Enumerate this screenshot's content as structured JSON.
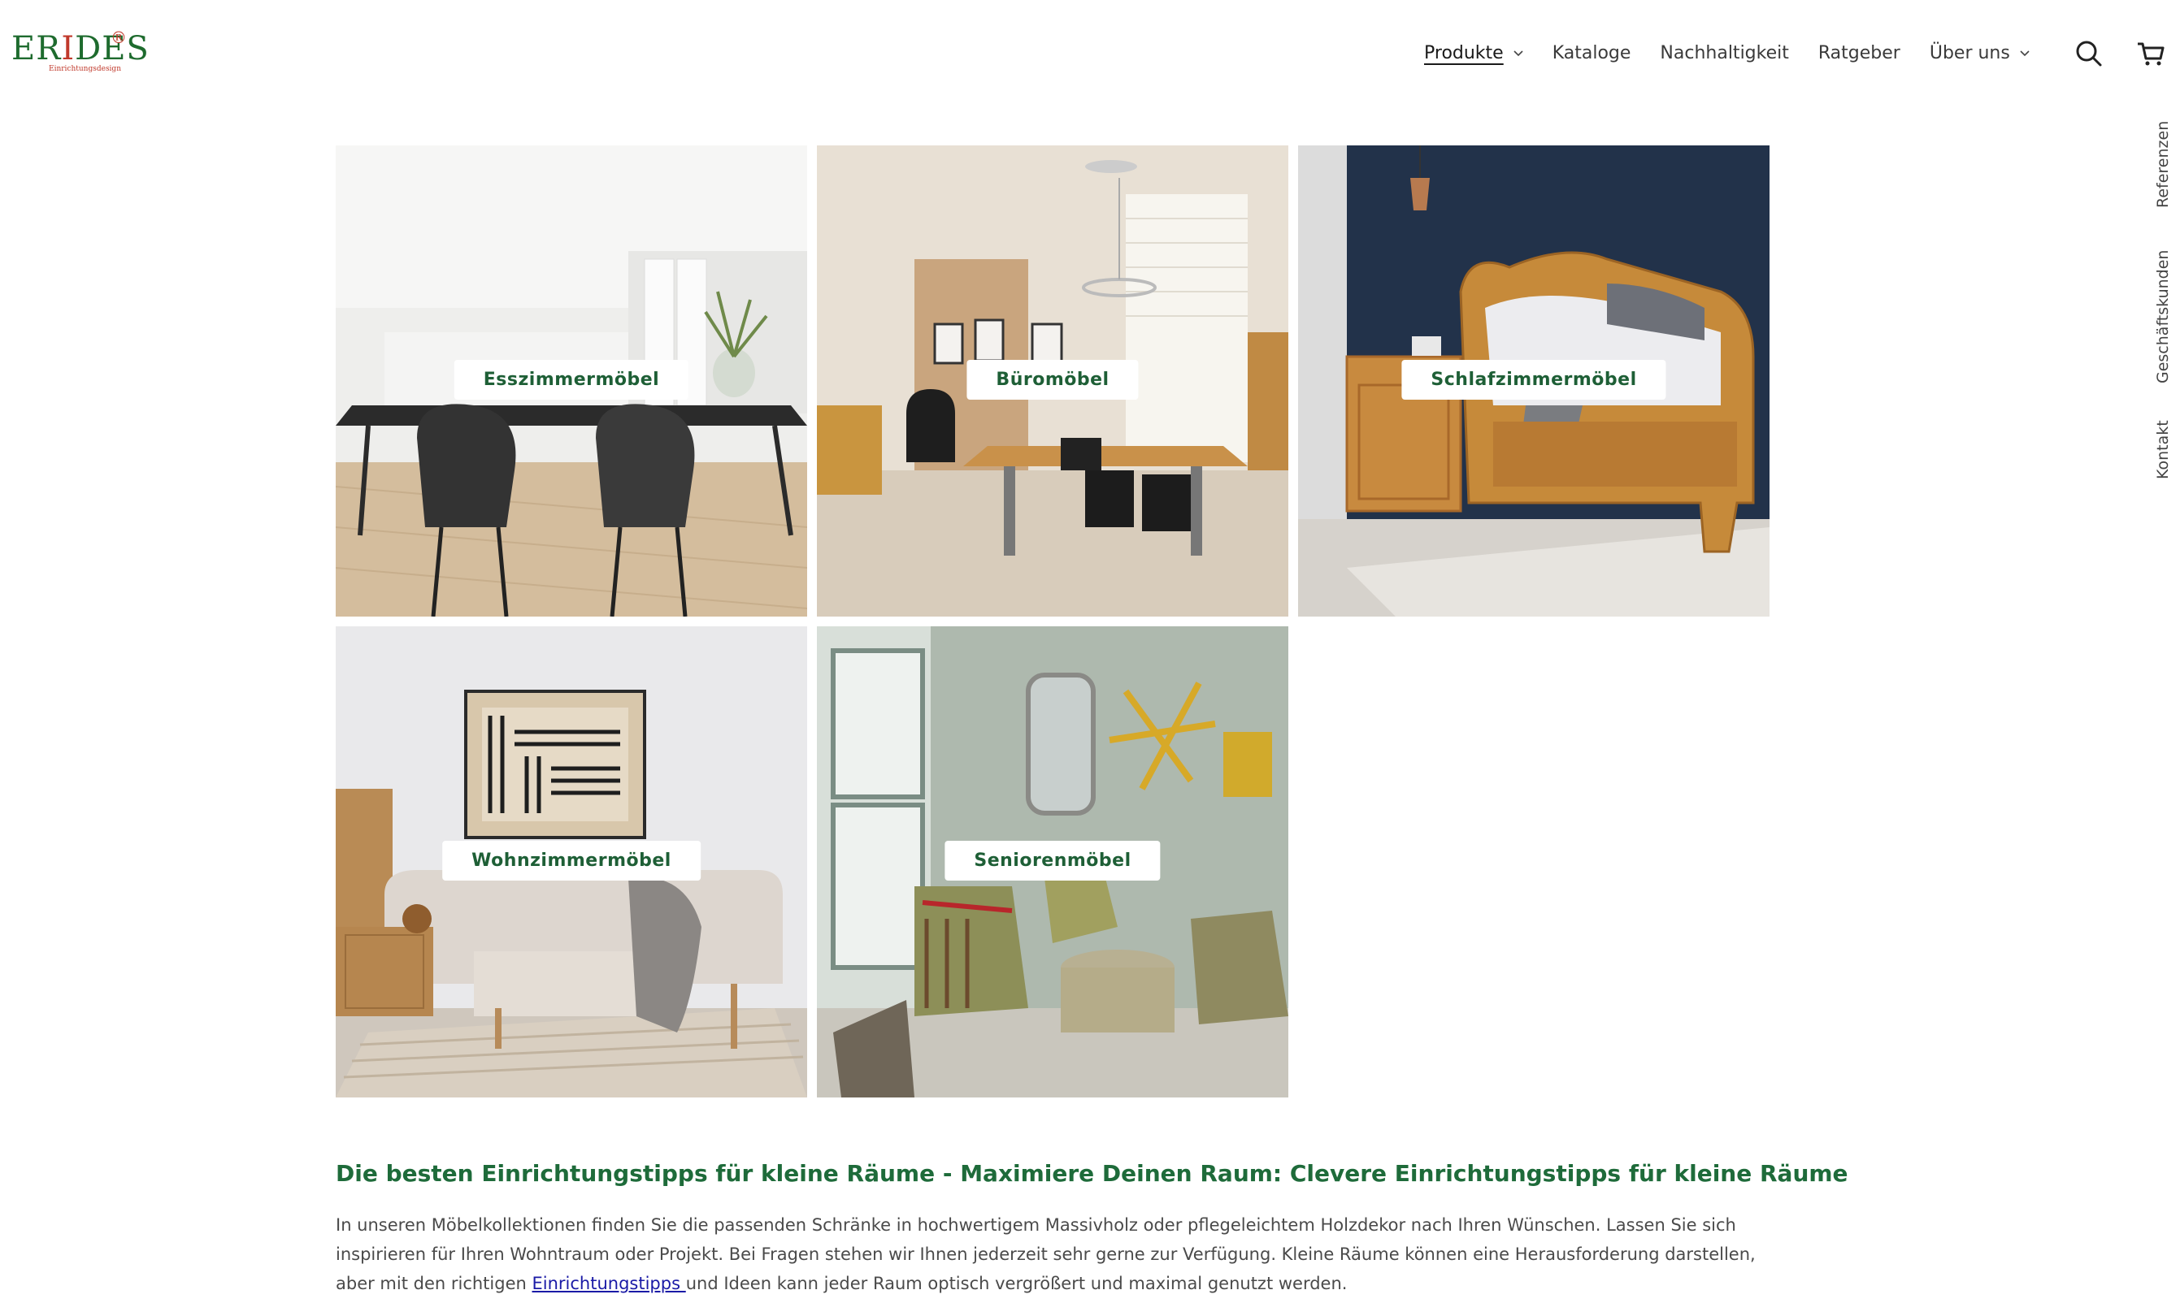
{
  "brand": {
    "name": "ERIDES",
    "registered": "®",
    "tagline": "Einrichtungsdesign",
    "colors": {
      "green": "#1e6b2e",
      "red": "#c0392b"
    }
  },
  "nav": {
    "items": [
      {
        "label": "Produkte",
        "dropdown": true,
        "active": true
      },
      {
        "label": "Kataloge",
        "dropdown": false
      },
      {
        "label": "Nachhaltigkeit",
        "dropdown": false
      },
      {
        "label": "Ratgeber",
        "dropdown": false
      },
      {
        "label": "Über uns",
        "dropdown": true
      }
    ],
    "icons": [
      "search-icon",
      "cart-icon"
    ]
  },
  "side_tabs": [
    "Referenzen",
    "Geschäftskunden",
    "Kontakt"
  ],
  "categories": [
    {
      "label": "Esszimmermöbel",
      "scene": "dining"
    },
    {
      "label": "Büromöbel",
      "scene": "office"
    },
    {
      "label": "Schlafzimmermöbel",
      "scene": "bedroom"
    },
    {
      "label": "Wohnzimmermöbel",
      "scene": "living"
    },
    {
      "label": "Seniorenmöbel",
      "scene": "senior"
    }
  ],
  "content": {
    "heading": "Die besten Einrichtungstipps für kleine Räume - Maximiere Deinen Raum: Clevere Einrichtungstipps für kleine Räume",
    "paragraph_before": "In unseren Möbelkollektionen finden Sie die passenden Schränke in hochwertigem Massivholz oder pflegeleichtem Holzdekor nach Ihren Wünschen. Lassen Sie sich inspirieren für Ihren Wohntraum oder Projekt. Bei Fragen stehen wir Ihnen jederzeit sehr gerne zur Verfügung. Kleine Räume können eine Herausforderung darstellen, aber mit den richtigen ",
    "link_text": "Einrichtungstipps ",
    "paragraph_after": "und Ideen kann jeder Raum optisch vergrößert und maximal genutzt werden.",
    "heading_color": "#1e6b3a",
    "link_color": "#1a1aa6"
  }
}
